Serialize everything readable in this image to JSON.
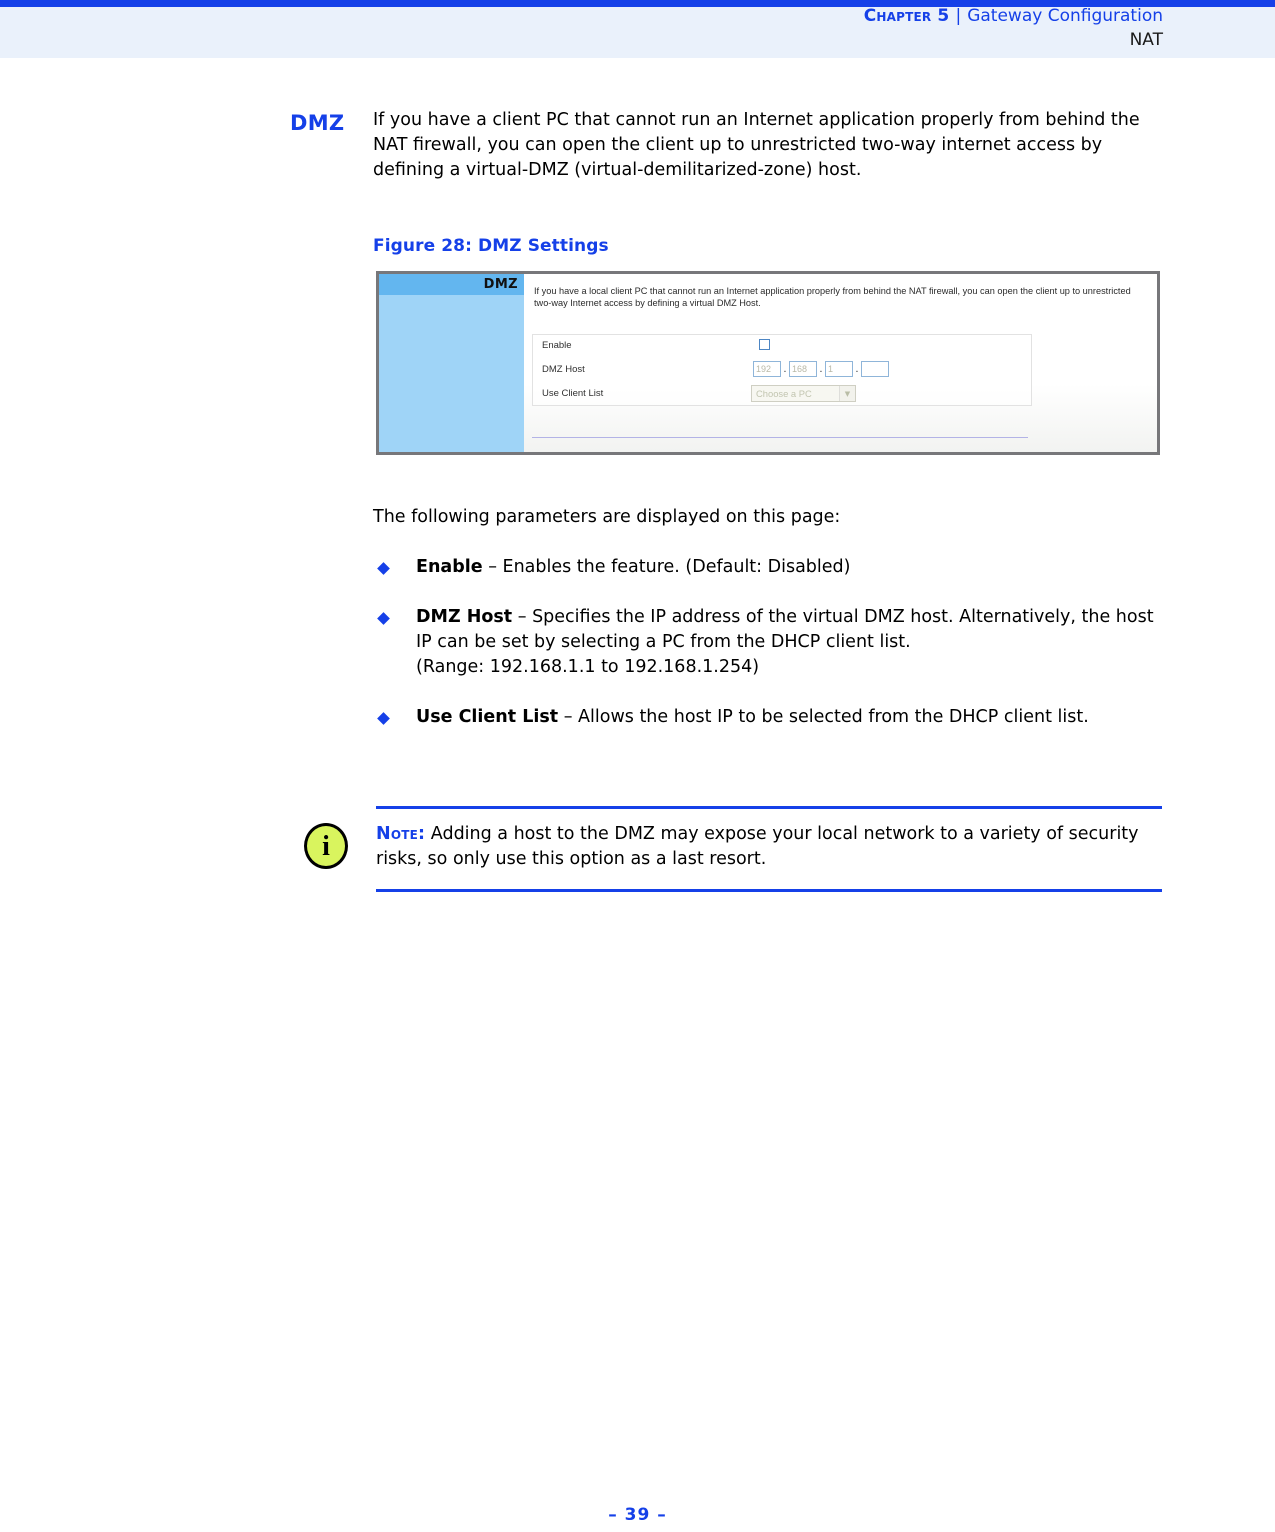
{
  "header": {
    "chapter": "Chapter 5",
    "separator": "|",
    "section": "Gateway Configuration",
    "subsection": "NAT"
  },
  "section": {
    "title": "DMZ",
    "body": "If you have a client PC that cannot run an Internet application properly from behind the NAT firewall, you can open the client up to unrestricted two-way internet access by defining a virtual-DMZ (virtual-demilitarized-zone) host."
  },
  "figure": {
    "caption": "Figure 28:  DMZ Settings",
    "sidebar_title": "DMZ",
    "description": "If you have a local client PC that cannot run an Internet application properly from behind the NAT firewall, you can open the client up to unrestricted two-way Internet access by defining a virtual DMZ Host.",
    "fields": {
      "enable_label": "Enable",
      "enable_checked": "",
      "dmz_host_label": "DMZ Host",
      "ip_octet_1": "192",
      "ip_octet_2": "168",
      "ip_octet_3": "1",
      "ip_octet_4": "",
      "ip_dot": ".",
      "use_client_list_label": "Use Client List",
      "client_list_value": "Choose a PC",
      "client_list_arrow": "▼"
    }
  },
  "intro_line": "The following parameters are displayed on this page:",
  "parameters": [
    {
      "term": "Enable",
      "dash": " – ",
      "description": "Enables the feature. (Default: Disabled)"
    },
    {
      "term": "DMZ Host",
      "dash": " – ",
      "description": "Specifies the IP address of the virtual DMZ host. Alternatively, the host IP can be set by selecting a PC from the DHCP client list.",
      "extra": "(Range: 192.168.1.1 to 192.168.1.254)"
    },
    {
      "term": "Use Client List",
      "dash": " – ",
      "description": "Allows the host IP to be selected from the DHCP client list."
    }
  ],
  "note": {
    "icon_glyph": "i",
    "label": "Note:",
    "text": " Adding a host to the DMZ may expose your local network to a variety of security risks, so only use this option as a last resort."
  },
  "footer": {
    "page_marker": "–  39  –"
  },
  "colors": {
    "accent_blue": "#1540e8",
    "header_band": "#eaf1fb",
    "note_icon": "#d9f45e",
    "fig_sidebar_head": "#63b6ef",
    "fig_sidebar_body": "#9fd4f7"
  }
}
